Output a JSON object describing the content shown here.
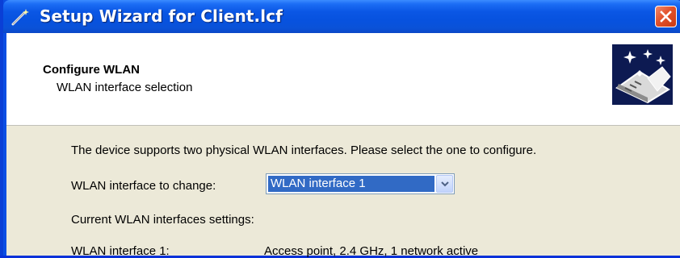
{
  "window": {
    "title": "Setup Wizard for Client.lcf"
  },
  "header": {
    "title": "Configure WLAN",
    "subtitle": "WLAN interface selection"
  },
  "body": {
    "intro_text": "The device supports two physical WLAN interfaces. Please select the one to configure.",
    "interface_label": "WLAN interface to change:",
    "interface_select": {
      "selected": "WLAN interface 1"
    },
    "current_label": "Current WLAN interfaces settings:",
    "interfaces": [
      {
        "name": "WLAN interface 1:",
        "value": "Access point, 2.4 GHz, 1 network active"
      }
    ]
  },
  "colors": {
    "titlebar": "#0b57e5",
    "panel": "#ece9d8",
    "selection": "#316ac5",
    "close": "#e2512a"
  },
  "icons": [
    "wizard-wand-icon",
    "close-icon",
    "wizard-header-icon",
    "chevron-down-icon"
  ]
}
